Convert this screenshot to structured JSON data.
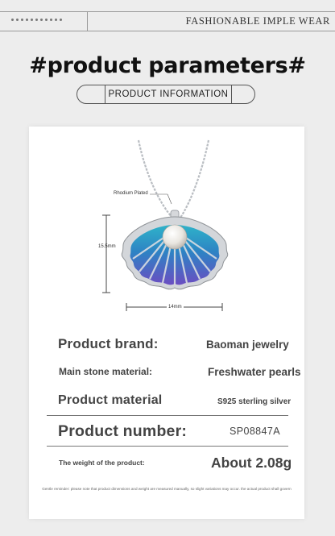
{
  "header": {
    "slogan": "FASHIONABLE IMPLE WEAR"
  },
  "heading": {
    "title": "#product parameters#",
    "subtitle": "PRODUCT INFORMATION"
  },
  "product_image": {
    "plating_label": "Rhodium Plated",
    "height_label": "15.5mm",
    "width_label": "14mm",
    "colors": {
      "shell_top": "#2fb3c9",
      "shell_mid": "#2d83c4",
      "shell_bottom": "#6a4ec2",
      "silver": "#c9ccd0"
    }
  },
  "parameters": [
    {
      "label": "Product brand:",
      "value": "Baoman jewelry"
    },
    {
      "label": "Main stone material:",
      "value": "Freshwater pearls"
    },
    {
      "label": "Product material",
      "value": "S925 sterling silver"
    },
    {
      "label": "Product number:",
      "value": "SP08847A"
    },
    {
      "label": "The weight of the product:",
      "value": "About 2.08g"
    }
  ],
  "footnote": "Gentle reminder: please note that product dimensions and weight are measured manually, so slight variations may occur. the actual product shall govern"
}
